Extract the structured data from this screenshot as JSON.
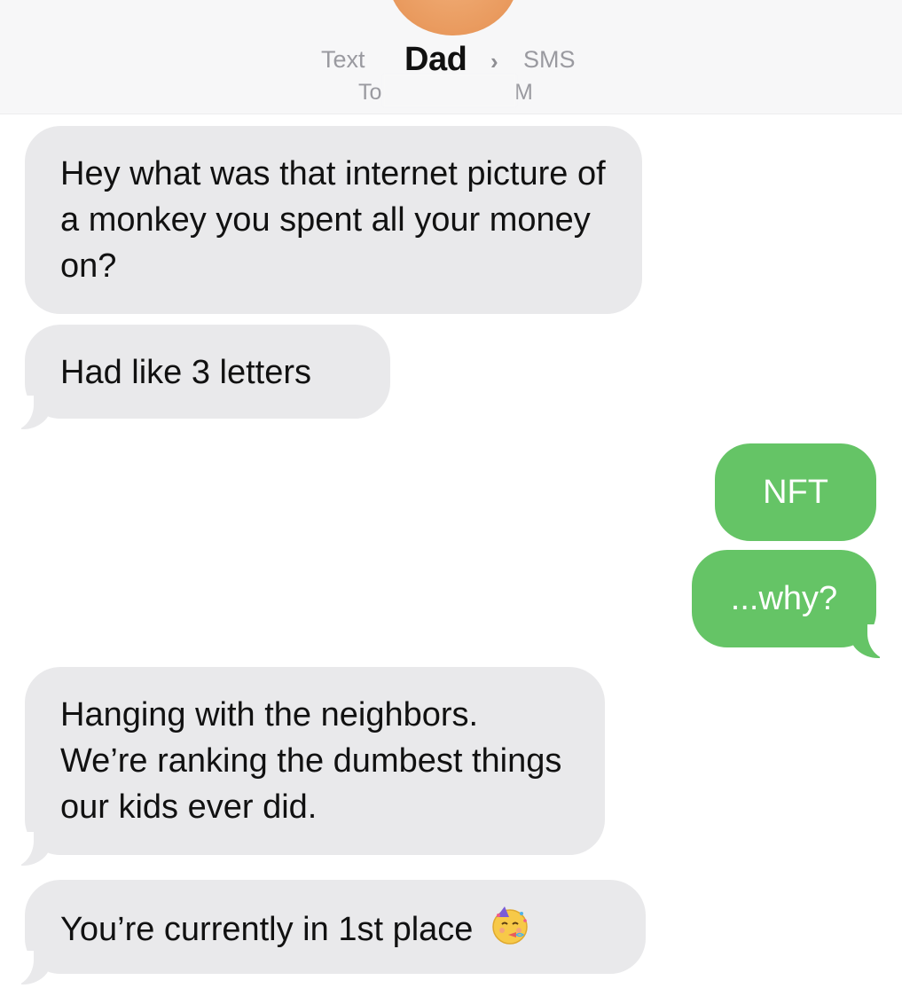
{
  "header": {
    "left_label": "Text",
    "contact_name": "Dad",
    "chevron": "›",
    "right_label": "SMS",
    "sub_left": "To",
    "sub_right": "M"
  },
  "messages": [
    {
      "direction": "incoming",
      "text": "Hey what was that internet picture of a monkey you spent all your money on?"
    },
    {
      "direction": "incoming",
      "text": "Had like 3 letters"
    },
    {
      "direction": "outgoing",
      "text": "NFT"
    },
    {
      "direction": "outgoing",
      "text": "...why?"
    },
    {
      "direction": "incoming",
      "text": "Hanging with the neighbors. We’re ranking the dumbest things our kids ever did."
    },
    {
      "direction": "incoming",
      "text": "You’re currently in 1st place",
      "emoji": "partying-face-icon"
    }
  ],
  "colors": {
    "incoming_bubble": "#e9e9eb",
    "outgoing_bubble": "#65c466",
    "outgoing_text": "#ffffff",
    "header_bg": "#f7f7f8"
  }
}
